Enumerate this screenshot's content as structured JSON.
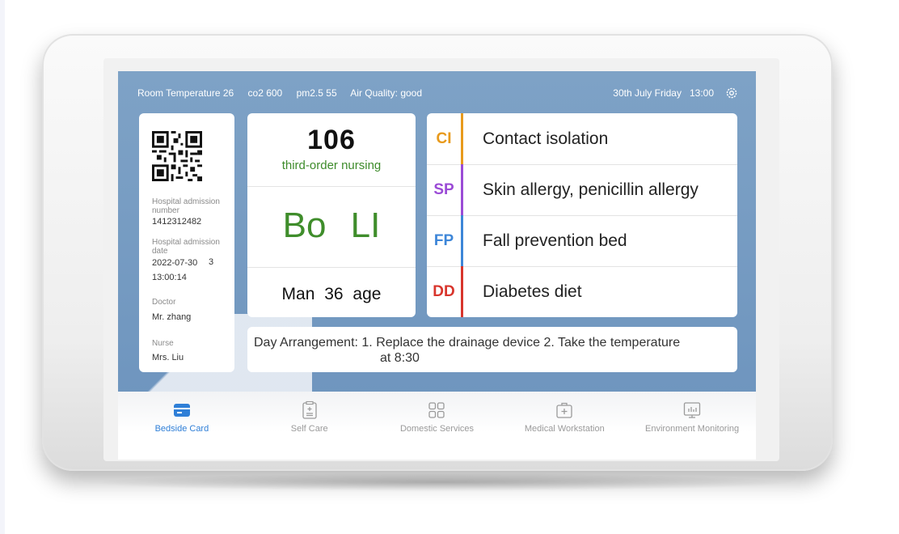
{
  "status_bar": {
    "room_temperature": "Room Temperature 26",
    "co2": "co2 600",
    "pm25": "pm2.5 55",
    "air_quality": "Air Quality: good",
    "date": "30th July Friday",
    "time": "13:00"
  },
  "patient_card": {
    "admission_number_label": "Hospital admission number",
    "admission_number": "1412312482",
    "admission_date_label": "Hospital admission date",
    "admission_date": "2022-07-30",
    "admission_date_suffix": "3",
    "admission_time": "13:00:14",
    "doctor_label": "Doctor",
    "doctor": "Mr. zhang",
    "nurse_label": "Nurse",
    "nurse": "Mrs. Liu"
  },
  "bed": {
    "number": "106",
    "nursing_level": "third-order nursing",
    "patient_name": "Bo LI",
    "patient_info": "Man 36 age"
  },
  "alerts": [
    {
      "code": "CI",
      "text": "Contact isolation",
      "color": "#e89a1c"
    },
    {
      "code": "SP",
      "text": "Skin allergy, penicillin allergy",
      "color": "#9b4bd6"
    },
    {
      "code": "FP",
      "text": "Fall prevention bed",
      "color": "#3d86d8"
    },
    {
      "code": "DD",
      "text": "Diabetes diet",
      "color": "#d8352c"
    }
  ],
  "arrangement": {
    "line1": "Day Arrangement: 1. Replace the drainage device 2. Take the temperature",
    "line2": "at 8:30"
  },
  "nav": [
    {
      "label": "Bedside Card",
      "icon": "card-icon",
      "active": true
    },
    {
      "label": "Self Care",
      "icon": "clipboard-icon",
      "active": false
    },
    {
      "label": "Domestic Services",
      "icon": "grid-icon",
      "active": false
    },
    {
      "label": "Medical Workstation",
      "icon": "medical-kit-icon",
      "active": false
    },
    {
      "label": "Environment Monitoring",
      "icon": "monitor-chart-icon",
      "active": false
    }
  ],
  "colors": {
    "screen_blue": "#7ea2c6",
    "active_nav": "#2f7fd7",
    "name_green": "#3f8d2b"
  }
}
